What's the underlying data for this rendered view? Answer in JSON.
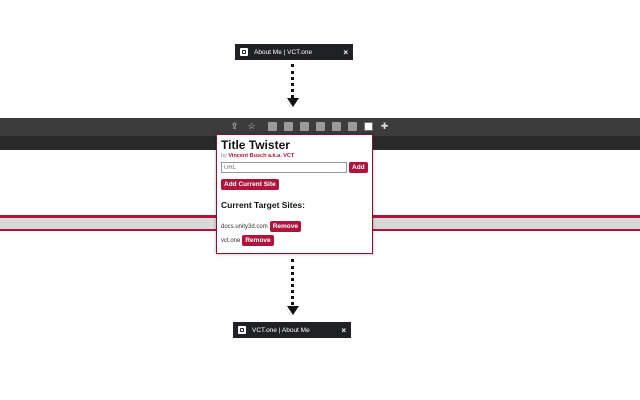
{
  "top_tab": {
    "title": "About Me | VCT.one",
    "close": "×"
  },
  "bottom_tab": {
    "title": "VCT.one | About Me",
    "close": "×"
  },
  "toolbar": {
    "share_icon": "share-icon",
    "star_icon": "star-icon",
    "puzzle_icon": "puzzle-icon"
  },
  "popup": {
    "title": "Title Twister",
    "by_prefix": "by",
    "author": "Vincent Busch a.k.a. VCT",
    "url_placeholder": "URL",
    "add_label": "Add",
    "add_current_label": "Add Current Site",
    "targets_heading": "Current Target Sites:",
    "sites": [
      {
        "domain": "docs.unity3d.com",
        "remove_label": "Remove"
      },
      {
        "domain": "vct.one",
        "remove_label": "Remove"
      }
    ]
  },
  "colors": {
    "accent": "#b0133c",
    "tab_bg": "#202124",
    "toolbar_bg": "#3c3c3c"
  }
}
